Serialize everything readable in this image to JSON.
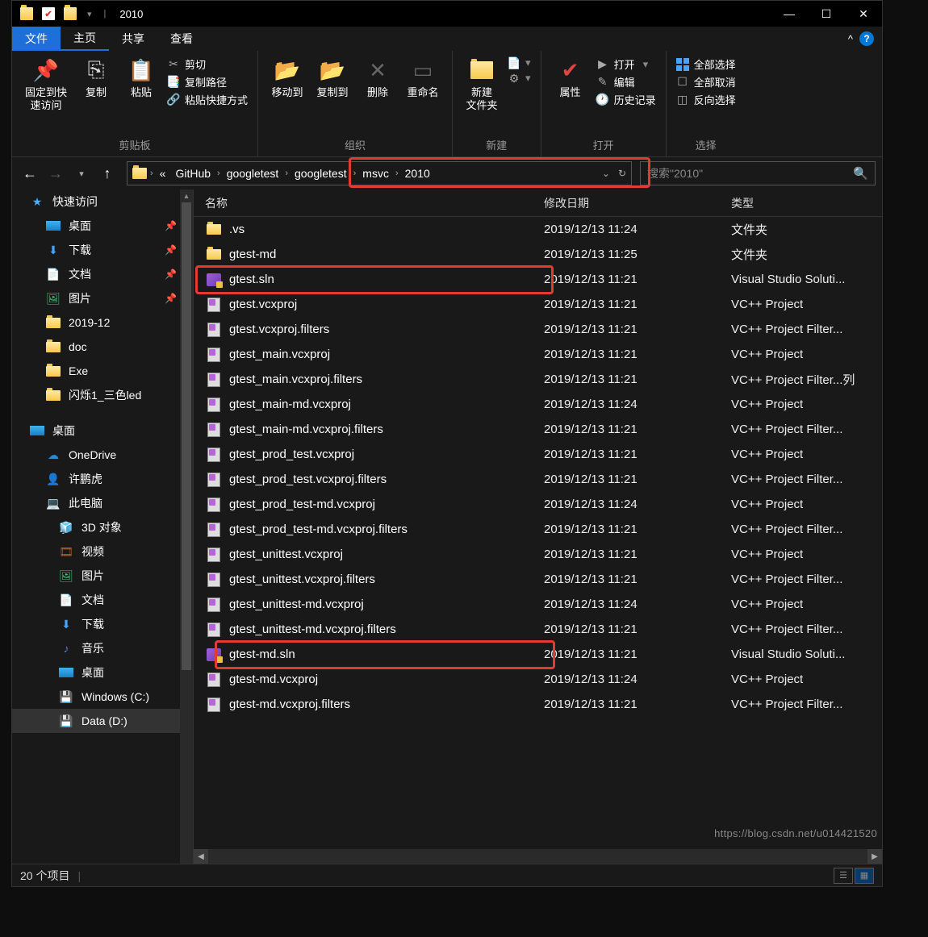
{
  "title": "2010",
  "tabs": {
    "file": "文件",
    "home": "主页",
    "share": "共享",
    "view": "查看"
  },
  "ribbon": {
    "clipboard": {
      "label": "剪贴板",
      "pin": "固定到快\n速访问",
      "copy": "复制",
      "paste": "粘贴",
      "cut": "剪切",
      "copypath": "复制路径",
      "pasteshort": "粘贴快捷方式"
    },
    "organize": {
      "label": "组织",
      "moveto": "移动到",
      "copyto": "复制到",
      "delete": "删除",
      "rename": "重命名"
    },
    "new": {
      "label": "新建",
      "newfolder": "新建\n文件夹"
    },
    "open": {
      "label": "打开",
      "props": "属性",
      "open": "打开",
      "edit": "编辑",
      "history": "历史记录"
    },
    "select": {
      "label": "选择",
      "all": "全部选择",
      "none": "全部取消",
      "invert": "反向选择"
    }
  },
  "breadcrumb": [
    "GitHub",
    "googletest",
    "googletest",
    "msvc",
    "2010"
  ],
  "search_placeholder": "搜索\"2010\"",
  "columns": {
    "name": "名称",
    "date": "修改日期",
    "type": "类型"
  },
  "sidebar": [
    {
      "icon": "star",
      "label": "快速访问",
      "lvl": 1
    },
    {
      "icon": "desktop",
      "label": "桌面",
      "lvl": 2,
      "pin": true
    },
    {
      "icon": "down",
      "label": "下载",
      "lvl": 2,
      "pin": true
    },
    {
      "icon": "doc",
      "label": "文档",
      "lvl": 2,
      "pin": true
    },
    {
      "icon": "pic",
      "label": "图片",
      "lvl": 2,
      "pin": true
    },
    {
      "icon": "folder",
      "label": "2019-12",
      "lvl": 2
    },
    {
      "icon": "folder",
      "label": "doc",
      "lvl": 2
    },
    {
      "icon": "folder",
      "label": "Exe",
      "lvl": 2
    },
    {
      "icon": "folder",
      "label": "闪烁1_三色led",
      "lvl": 2
    },
    {
      "icon": "desktop",
      "label": "桌面",
      "lvl": 1
    },
    {
      "icon": "cloud",
      "label": "OneDrive",
      "lvl": 2
    },
    {
      "icon": "user",
      "label": "许鹏虎",
      "lvl": 2
    },
    {
      "icon": "pc",
      "label": "此电脑",
      "lvl": 2
    },
    {
      "icon": "cube",
      "label": "3D 对象",
      "lvl": 3
    },
    {
      "icon": "video",
      "label": "视频",
      "lvl": 3
    },
    {
      "icon": "pic",
      "label": "图片",
      "lvl": 3
    },
    {
      "icon": "doc",
      "label": "文档",
      "lvl": 3
    },
    {
      "icon": "down",
      "label": "下载",
      "lvl": 3
    },
    {
      "icon": "music",
      "label": "音乐",
      "lvl": 3
    },
    {
      "icon": "desktop",
      "label": "桌面",
      "lvl": 3
    },
    {
      "icon": "drive",
      "label": "Windows (C:)",
      "lvl": 3
    },
    {
      "icon": "drive",
      "label": "Data (D:)",
      "lvl": 3,
      "sel": true
    }
  ],
  "files": [
    {
      "icon": "folder",
      "name": ".vs",
      "date": "2019/12/13 11:24",
      "type": "文件夹"
    },
    {
      "icon": "folder",
      "name": "gtest-md",
      "date": "2019/12/13 11:25",
      "type": "文件夹"
    },
    {
      "icon": "sln",
      "name": "gtest.sln",
      "date": "2019/12/13 11:21",
      "type": "Visual Studio Soluti..."
    },
    {
      "icon": "proj",
      "name": "gtest.vcxproj",
      "date": "2019/12/13 11:21",
      "type": "VC++ Project"
    },
    {
      "icon": "proj",
      "name": "gtest.vcxproj.filters",
      "date": "2019/12/13 11:21",
      "type": "VC++ Project Filter..."
    },
    {
      "icon": "proj",
      "name": "gtest_main.vcxproj",
      "date": "2019/12/13 11:21",
      "type": "VC++ Project"
    },
    {
      "icon": "proj",
      "name": "gtest_main.vcxproj.filters",
      "date": "2019/12/13 11:21",
      "type": "VC++ Project Filter...列"
    },
    {
      "icon": "proj",
      "name": "gtest_main-md.vcxproj",
      "date": "2019/12/13 11:24",
      "type": "VC++ Project"
    },
    {
      "icon": "proj",
      "name": "gtest_main-md.vcxproj.filters",
      "date": "2019/12/13 11:21",
      "type": "VC++ Project Filter..."
    },
    {
      "icon": "proj",
      "name": "gtest_prod_test.vcxproj",
      "date": "2019/12/13 11:21",
      "type": "VC++ Project"
    },
    {
      "icon": "proj",
      "name": "gtest_prod_test.vcxproj.filters",
      "date": "2019/12/13 11:21",
      "type": "VC++ Project Filter..."
    },
    {
      "icon": "proj",
      "name": "gtest_prod_test-md.vcxproj",
      "date": "2019/12/13 11:24",
      "type": "VC++ Project"
    },
    {
      "icon": "proj",
      "name": "gtest_prod_test-md.vcxproj.filters",
      "date": "2019/12/13 11:21",
      "type": "VC++ Project Filter..."
    },
    {
      "icon": "proj",
      "name": "gtest_unittest.vcxproj",
      "date": "2019/12/13 11:21",
      "type": "VC++ Project"
    },
    {
      "icon": "proj",
      "name": "gtest_unittest.vcxproj.filters",
      "date": "2019/12/13 11:21",
      "type": "VC++ Project Filter..."
    },
    {
      "icon": "proj",
      "name": "gtest_unittest-md.vcxproj",
      "date": "2019/12/13 11:24",
      "type": "VC++ Project"
    },
    {
      "icon": "proj",
      "name": "gtest_unittest-md.vcxproj.filters",
      "date": "2019/12/13 11:21",
      "type": "VC++ Project Filter..."
    },
    {
      "icon": "sln",
      "name": "gtest-md.sln",
      "date": "2019/12/13 11:21",
      "type": "Visual Studio Soluti..."
    },
    {
      "icon": "proj",
      "name": "gtest-md.vcxproj",
      "date": "2019/12/13 11:24",
      "type": "VC++ Project"
    },
    {
      "icon": "proj",
      "name": "gtest-md.vcxproj.filters",
      "date": "2019/12/13 11:21",
      "type": "VC++ Project Filter..."
    }
  ],
  "status": "20 个项目",
  "watermark": "https://blog.csdn.net/u014421520"
}
